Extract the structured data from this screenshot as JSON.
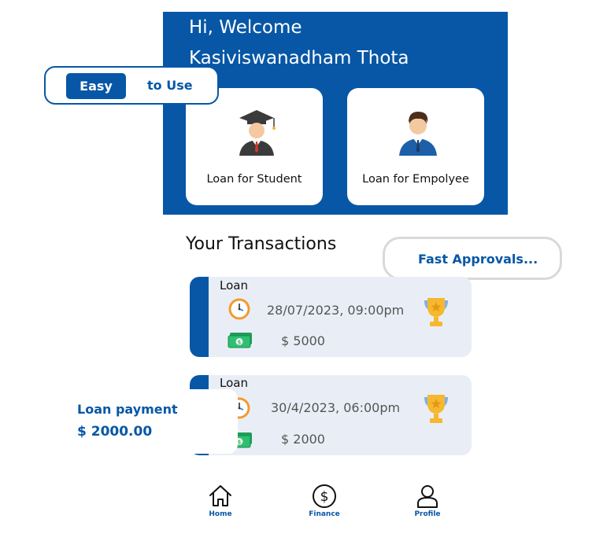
{
  "header": {
    "greeting": "Hi, Welcome",
    "user_name": "Kasiviswanadham Thota",
    "cards": [
      {
        "label": "Loan for Student",
        "icon": "graduate-icon"
      },
      {
        "label": "Loan for Empolyee",
        "icon": "employee-icon"
      }
    ]
  },
  "badges": {
    "easy_chip": "Easy",
    "easy_rest": "to Use",
    "fast": "Fast Approvals..."
  },
  "transactions_title": "Your Transactions",
  "transactions": [
    {
      "type": "Loan",
      "datetime": "28/07/2023,  09:00pm",
      "amount": "$ 5000"
    },
    {
      "type": "Loan",
      "datetime": "30/4/2023,  06:00pm",
      "amount": "$ 2000"
    }
  ],
  "payment_overlay": {
    "title": "Loan payment",
    "amount": "$ 2000.00"
  },
  "nav": {
    "home": "Home",
    "finance": "Finance",
    "profile": "Profile"
  },
  "colors": {
    "primary": "#0757a6",
    "card_bg": "#e9eef6"
  }
}
